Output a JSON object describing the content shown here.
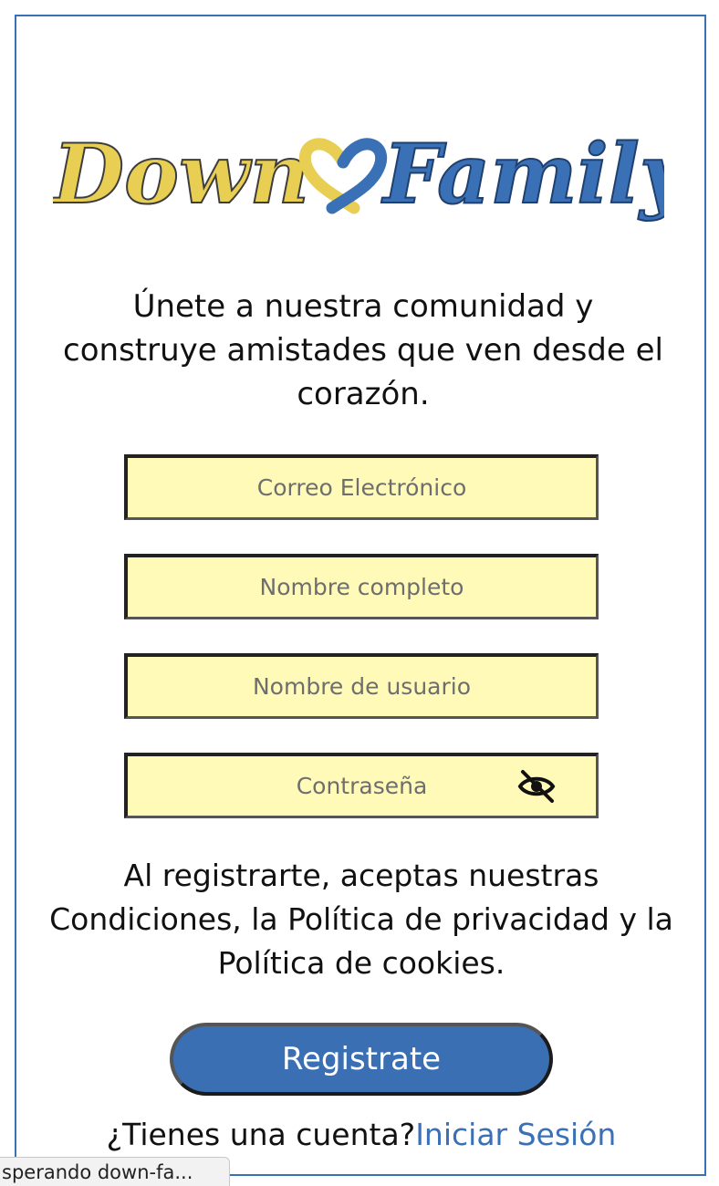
{
  "logo": {
    "word_left": "Down",
    "word_right": "Family",
    "color_left": "#e8cf54",
    "color_right": "#3a70b5",
    "icon": "heart-icon"
  },
  "tagline": "Únete a nuestra comunidad y construye amistades que ven desde el corazón.",
  "form": {
    "email_placeholder": "Correo Electrónico",
    "fullname_placeholder": "Nombre completo",
    "username_placeholder": "Nombre de usuario",
    "password_placeholder": "Contraseña",
    "password_toggle_icon": "eye-slash-icon",
    "field_bg_color": "#fffab8"
  },
  "terms": "Al registrarte, aceptas nuestras Condiciones, la Política de privacidad y la Política de cookies.",
  "register_button": {
    "label": "Registrate",
    "color": "#3a6fb3"
  },
  "login": {
    "prompt": "¿Tienes una cuenta?",
    "link_label": "Iniciar Sesión",
    "link_color": "#3a70b5"
  },
  "status_bar": {
    "text": "sperando down-fa..."
  }
}
